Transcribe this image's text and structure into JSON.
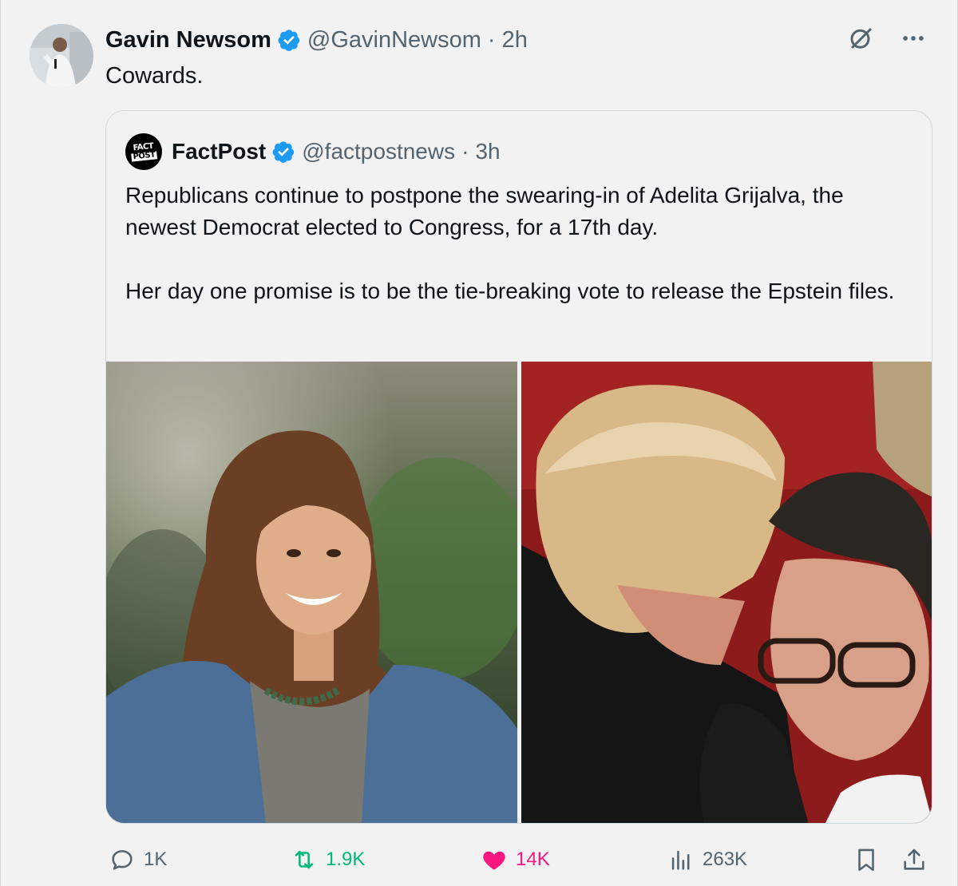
{
  "author": {
    "name": "Gavin Newsom",
    "handle": "@GavinNewsom",
    "separator": "·",
    "time": "2h"
  },
  "tweet": {
    "text": "Cowards."
  },
  "quote": {
    "author": {
      "name": "FactPost",
      "handle": "@factpostnews",
      "separator": "·",
      "time": "3h",
      "logo_text_top": "FACT",
      "logo_text_bottom": "POST"
    },
    "paragraphs": [
      "Republicans continue to postpone the swearing-in of Adelita Grijalva, the newest Democrat elected to Congress, for a 17th day.",
      "Her day one promise is to be the tie-breaking vote to release the Epstein files."
    ]
  },
  "actions": {
    "replies": "1K",
    "retweets": "1.9K",
    "likes": "14K",
    "views": "263K"
  },
  "icons": {
    "verified": "verified-badge-icon",
    "grok": "grok-icon",
    "more": "more-icon",
    "reply": "reply-icon",
    "retweet": "retweet-icon",
    "like": "heart-icon",
    "views": "views-icon",
    "bookmark": "bookmark-icon",
    "share": "share-icon"
  },
  "colors": {
    "verified": "#1d9bf0",
    "retweet": "#00ba7c",
    "like": "#f91880",
    "secondary_text": "#536471"
  }
}
